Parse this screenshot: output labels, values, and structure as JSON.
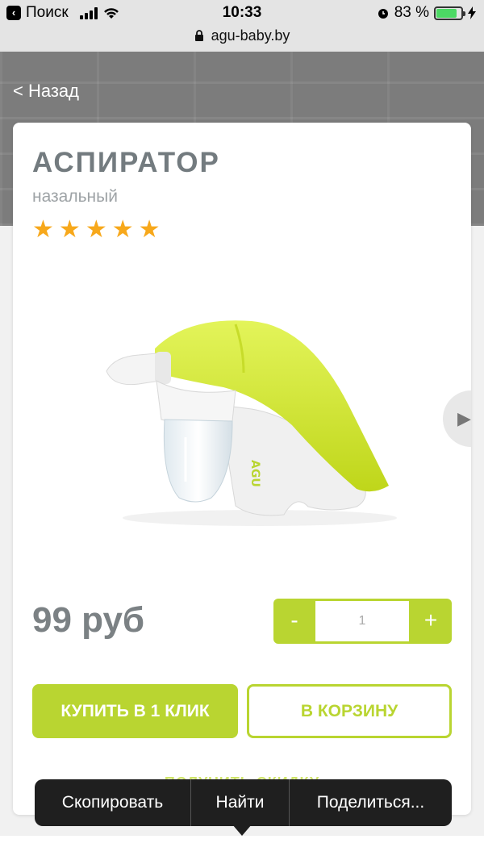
{
  "status_bar": {
    "back_app": "Поиск",
    "time": "10:33",
    "battery_percent": "83 %"
  },
  "url_bar": {
    "domain": "agu-baby.by"
  },
  "hero": {
    "back_label": "< Назад"
  },
  "product": {
    "title": "АСПИРАТОР",
    "subtitle": "назальный",
    "rating": 5,
    "brand_on_product": "AGU",
    "price": "99 руб",
    "quantity": "1",
    "minus_label": "-",
    "plus_label": "+",
    "buy_one_click": "КУПИТЬ В 1 КЛИК",
    "add_to_cart": "В КОРЗИНУ",
    "get_discount": "ПОЛУЧИТЬ СКИДКУ"
  },
  "context_menu": {
    "items": [
      "Скопировать",
      "Найти",
      "Поделиться..."
    ]
  },
  "colors": {
    "accent": "#b9d531",
    "star": "#f7a81b",
    "title": "#737b7f"
  }
}
